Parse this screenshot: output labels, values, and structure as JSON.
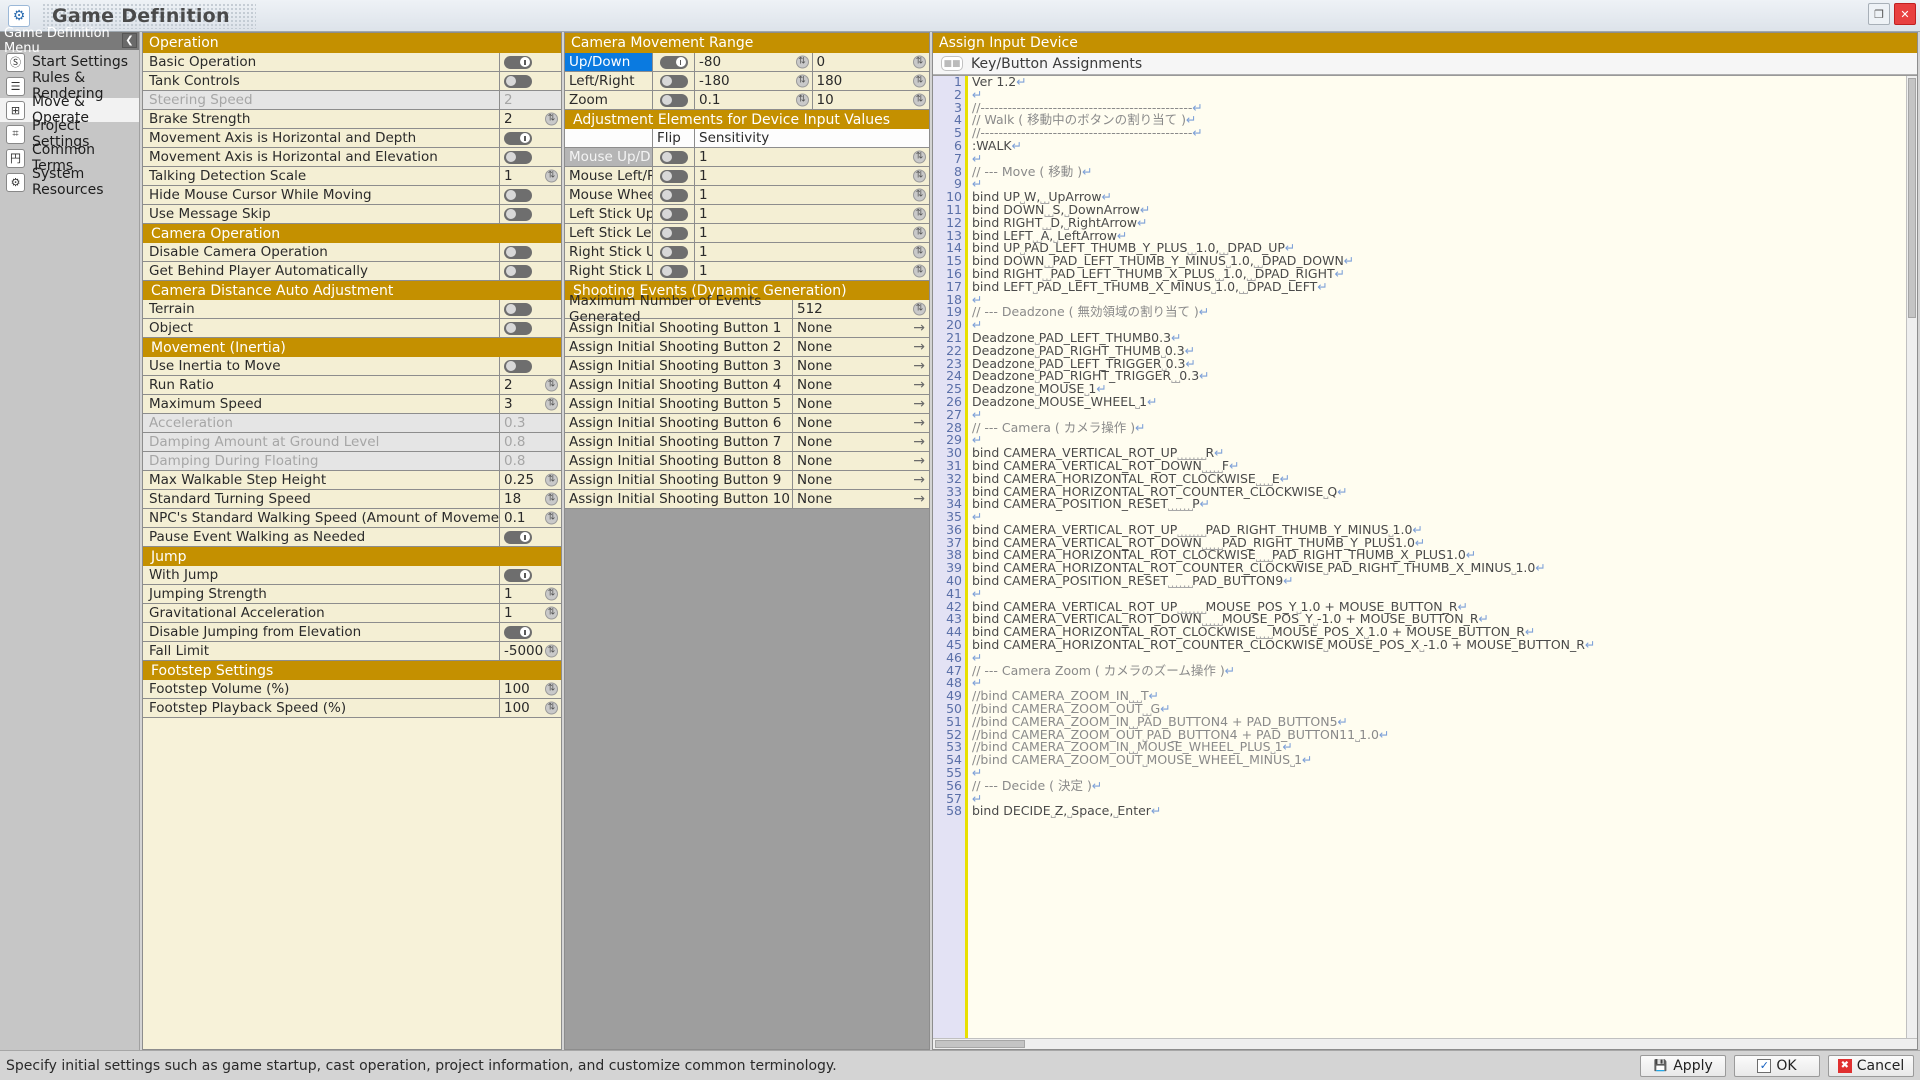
{
  "window": {
    "title": "Game Definition",
    "icon": "app-gear-icon",
    "buttons": {
      "restore": "❐",
      "close": "✕"
    }
  },
  "sidebar": {
    "header": "Game Definition Menu",
    "collapse": "❮",
    "items": [
      {
        "label": "Start Settings",
        "icon": "Ⓢ",
        "active": false
      },
      {
        "label": "Rules & Rendering",
        "icon": "☰",
        "active": false
      },
      {
        "label": "Move & Operate",
        "icon": "⊞",
        "active": true
      },
      {
        "label": "Project Settings",
        "icon": "⌗",
        "active": false
      },
      {
        "label": "Common Terms",
        "icon": "円",
        "active": false
      },
      {
        "label": "System Resources",
        "icon": "⚙",
        "active": false
      }
    ]
  },
  "operation_panel": {
    "header": "Operation",
    "rows": [
      {
        "kind": "row",
        "label": "Basic Operation",
        "type": "toggle",
        "on": true
      },
      {
        "kind": "row",
        "label": "Tank Controls",
        "type": "toggle",
        "on": false
      },
      {
        "kind": "row",
        "label": "Steering Speed",
        "type": "text",
        "value": "2",
        "disabled": true
      },
      {
        "kind": "row",
        "label": "Brake Strength",
        "type": "spin",
        "value": "2"
      },
      {
        "kind": "row",
        "label": "Movement Axis is Horizontal and Depth",
        "type": "toggle",
        "on": true
      },
      {
        "kind": "row",
        "label": "Movement Axis is Horizontal and Elevation",
        "type": "toggle",
        "on": false
      },
      {
        "kind": "row",
        "label": "Talking Detection Scale",
        "type": "spin",
        "value": "1"
      },
      {
        "kind": "row",
        "label": "Hide Mouse Cursor While Moving",
        "type": "toggle",
        "on": false
      },
      {
        "kind": "row",
        "label": "Use Message Skip",
        "type": "toggle",
        "on": false
      },
      {
        "kind": "group",
        "label": "Camera Operation"
      },
      {
        "kind": "row",
        "label": "Disable Camera Operation",
        "type": "toggle",
        "on": false
      },
      {
        "kind": "row",
        "label": "Get Behind Player Automatically",
        "type": "toggle",
        "on": false
      },
      {
        "kind": "group",
        "label": "Camera Distance Auto Adjustment"
      },
      {
        "kind": "row",
        "label": "Terrain",
        "type": "toggle",
        "on": false
      },
      {
        "kind": "row",
        "label": "Object",
        "type": "toggle",
        "on": false
      },
      {
        "kind": "group",
        "label": "Movement (Inertia)"
      },
      {
        "kind": "row",
        "label": "Use Inertia to Move",
        "type": "toggle",
        "on": false
      },
      {
        "kind": "row",
        "label": "Run Ratio",
        "type": "spin",
        "value": "2"
      },
      {
        "kind": "row",
        "label": "Maximum Speed",
        "type": "spin",
        "value": "3"
      },
      {
        "kind": "row",
        "label": "Acceleration",
        "type": "text",
        "value": "0.3",
        "disabled": true
      },
      {
        "kind": "row",
        "label": "Damping Amount at Ground Level",
        "type": "text",
        "value": "0.8",
        "disabled": true
      },
      {
        "kind": "row",
        "label": "Damping During Floating",
        "type": "text",
        "value": "0.8",
        "disabled": true
      },
      {
        "kind": "row",
        "label": "Max Walkable Step Height",
        "type": "spin",
        "value": "0.25"
      },
      {
        "kind": "row",
        "label": "Standard Turning Speed",
        "type": "spin",
        "value": "18"
      },
      {
        "kind": "row",
        "label": "NPC's Standard Walking Speed (Amount of Movement per Frame)",
        "type": "spin",
        "value": "0.1"
      },
      {
        "kind": "row",
        "label": "Pause Event Walking as Needed",
        "type": "toggle",
        "on": true
      },
      {
        "kind": "group",
        "label": "Jump"
      },
      {
        "kind": "row",
        "label": "With Jump",
        "type": "toggle",
        "on": true
      },
      {
        "kind": "row",
        "label": "Jumping Strength",
        "type": "spin",
        "value": "1"
      },
      {
        "kind": "row",
        "label": "Gravitational Acceleration",
        "type": "spin",
        "value": "1"
      },
      {
        "kind": "row",
        "label": "Disable Jumping from Elevation",
        "type": "toggle",
        "on": true
      },
      {
        "kind": "row",
        "label": "Fall Limit",
        "type": "spin",
        "value": "-5000"
      },
      {
        "kind": "group",
        "label": "Footstep Settings"
      },
      {
        "kind": "row",
        "label": "Footstep Volume (%)",
        "type": "spin",
        "value": "100"
      },
      {
        "kind": "row",
        "label": "Footstep Playback Speed (%)",
        "type": "spin",
        "value": "100"
      }
    ]
  },
  "camera_panel": {
    "header": "Camera Movement Range",
    "range_rows": [
      {
        "label": "Up/Down",
        "selected": true,
        "toggle_on": true,
        "min": "-80",
        "max": "0"
      },
      {
        "label": "Left/Right",
        "selected": false,
        "toggle_on": false,
        "min": "-180",
        "max": "180"
      },
      {
        "label": "Zoom",
        "selected": false,
        "toggle_on": false,
        "min": "0.1",
        "max": "10"
      }
    ],
    "adjust_header": "Adjustment Elements for Device Input Values",
    "adjust_columns": {
      "name": "",
      "flip": "Flip",
      "sensitivity": "Sensitivity"
    },
    "adjust_rows": [
      {
        "label": "Mouse Up/D…",
        "highlight": true,
        "flip_on": false,
        "sensitivity": "1"
      },
      {
        "label": "Mouse Left/R…",
        "highlight": false,
        "flip_on": false,
        "sensitivity": "1"
      },
      {
        "label": "Mouse Wheel",
        "highlight": false,
        "flip_on": false,
        "sensitivity": "1"
      },
      {
        "label": "Left Stick Up/…",
        "highlight": false,
        "flip_on": false,
        "sensitivity": "1"
      },
      {
        "label": "Left Stick Left…",
        "highlight": false,
        "flip_on": false,
        "sensitivity": "1"
      },
      {
        "label": "Right Stick U…",
        "highlight": false,
        "flip_on": false,
        "sensitivity": "1"
      },
      {
        "label": "Right Stick Le…",
        "highlight": false,
        "flip_on": false,
        "sensitivity": "1"
      }
    ],
    "shooting_header": "Shooting Events (Dynamic Generation)",
    "shooting_rows": [
      {
        "label": "Maximum Number of Events Generated",
        "value": "512",
        "type": "spin"
      },
      {
        "label": "Assign Initial Shooting Button 1",
        "value": "None",
        "type": "arrow"
      },
      {
        "label": "Assign Initial Shooting Button 2",
        "value": "None",
        "type": "arrow"
      },
      {
        "label": "Assign Initial Shooting Button 3",
        "value": "None",
        "type": "arrow"
      },
      {
        "label": "Assign Initial Shooting Button 4",
        "value": "None",
        "type": "arrow"
      },
      {
        "label": "Assign Initial Shooting Button 5",
        "value": "None",
        "type": "arrow"
      },
      {
        "label": "Assign Initial Shooting Button 6",
        "value": "None",
        "type": "arrow"
      },
      {
        "label": "Assign Initial Shooting Button 7",
        "value": "None",
        "type": "arrow"
      },
      {
        "label": "Assign Initial Shooting Button 8",
        "value": "None",
        "type": "arrow"
      },
      {
        "label": "Assign Initial Shooting Button 9",
        "value": "None",
        "type": "arrow"
      },
      {
        "label": "Assign Initial Shooting Button 10",
        "value": "None",
        "type": "arrow"
      }
    ]
  },
  "input_device_panel": {
    "header": "Assign Input Device",
    "subheader": "Key/Button Assignments",
    "subheader_icon": "gamepad-icon",
    "code_lines": [
      "Ver 1.2↵",
      "↵",
      "//-----------------------------------------------↵",
      "// Walk ( 移動中のボタンの割り当て )↵",
      "//-----------------------------------------------↵",
      ":WALK↵",
      "↵",
      "// --- Move ( 移動 )↵",
      "↵",
      "bind UP⎵W,⎵⎵UpArrow↵",
      "bind DOWN⎵⎵S,⎵DownArrow↵",
      "bind RIGHT⎵⎵D,⎵RightArrow↵",
      "bind LEFT⎵⎵A,⎵LeftArrow↵",
      "bind UP⎵PAD_LEFT_THUMB_Y_PLUS⎵⎵1.0,⎵⎵DPAD_UP↵",
      "bind DOWN⎵⎵PAD_LEFT_THUMB_Y_MINUS⎵1.0,⎵⎵DPAD_DOWN↵",
      "bind RIGHT⎵⎵PAD_LEFT_THUMB_X_PLUS⎵⎵1.0,⎵⎵DPAD_RIGHT↵",
      "bind LEFT⎵PAD_LEFT_THUMB_X_MINUS⎵1.0,⎵⎵DPAD_LEFT↵",
      "↵",
      "// --- Deadzone ( 無効領域の割り当て )↵",
      "↵",
      "Deadzone⎵PAD_LEFT_THUMB0.3↵",
      "Deadzone⎵PAD_RIGHT_THUMB⎵0.3↵",
      "Deadzone⎵PAD_LEFT_TRIGGER⎵0.3↵",
      "Deadzone⎵PAD_RIGHT_TRIGGER⎵⎵0.3↵",
      "Deadzone⎵MOUSE⎵1↵",
      "Deadzone⎵MOUSE_WHEEL⎵1↵",
      "↵",
      "// --- Camera ( カメラ操作 )↵",
      "↵",
      "bind CAMERA_VERTICAL_ROT_UP⎵⎵⎵⎵⎵⎵⎵R↵",
      "bind CAMERA_VERTICAL_ROT_DOWN⎵⎵⎵⎵⎵F↵",
      "bind CAMERA_HORIZONTAL_ROT_CLOCKWISE⎵⎵⎵⎵E↵",
      "bind CAMERA_HORIZONTAL_ROT_COUNTER_CLOCKWISE⎵Q↵",
      "bind CAMERA_POSITION_RESET⎵⎵⎵⎵⎵⎵P↵",
      "↵",
      "bind CAMERA_VERTICAL_ROT_UP⎵⎵⎵⎵⎵⎵⎵PAD_RIGHT_THUMB_Y_MINUS⎵1.0↵",
      "bind CAMERA_VERTICAL_ROT_DOWN⎵⎵⎵⎵⎵PAD_RIGHT_THUMB_Y_PLUS1.0↵",
      "bind CAMERA_HORIZONTAL_ROT_CLOCKWISE⎵⎵⎵⎵PAD_RIGHT_THUMB_X_PLUS1.0↵",
      "bind CAMERA_HORIZONTAL_ROT_COUNTER_CLOCKWISE⎵PAD_RIGHT_THUMB_X_MINUS⎵1.0↵",
      "bind CAMERA_POSITION_RESET⎵⎵⎵⎵⎵⎵PAD_BUTTON9↵",
      "↵",
      "bind CAMERA_VERTICAL_ROT_UP⎵⎵⎵⎵⎵⎵⎵MOUSE_POS_Y⎵1.0 + MOUSE_BUTTON_R↵",
      "bind CAMERA_VERTICAL_ROT_DOWN⎵⎵⎵⎵⎵MOUSE_POS_Y⎵-1.0 + MOUSE_BUTTON_R↵",
      "bind CAMERA_HORIZONTAL_ROT_CLOCKWISE⎵⎵⎵⎵MOUSE_POS_X⎵1.0 + MOUSE_BUTTON_R↵",
      "bind CAMERA_HORIZONTAL_ROT_COUNTER_CLOCKWISE⎵MOUSE_POS_X⎵-1.0 + MOUSE_BUTTON_R↵",
      "↵",
      "// --- Camera Zoom ( カメラのズーム操作 )↵",
      "↵",
      "//bind CAMERA_ZOOM_IN⎵⎵⎵T↵",
      "//bind CAMERA_ZOOM_OUT⎵⎵G↵",
      "//bind CAMERA_ZOOM_IN⎵⎵PAD_BUTTON4 + PAD_BUTTON5↵",
      "//bind CAMERA_ZOOM_OUT⎵PAD_BUTTON4 + PAD_BUTTON11⎵1.0↵",
      "//bind CAMERA_ZOOM_IN⎵⎵MOUSE_WHEEL_PLUS⎵1↵",
      "//bind CAMERA_ZOOM_OUT⎵MOUSE_WHEEL_MINUS⎵1↵",
      "↵",
      "// --- Decide ( 決定 )↵",
      "↵",
      "bind DECIDE⎵Z,⎵Space,⎵Enter↵"
    ]
  },
  "statusbar": {
    "message": "Specify initial settings such as game startup, cast operation, project information, and customize common terminology.",
    "apply": "Apply",
    "apply_icon": "apply-icon",
    "ok": "OK",
    "ok_icon": "check-icon",
    "cancel": "Cancel",
    "cancel_icon": "x-icon"
  },
  "colors": {
    "group_header": "#c49000",
    "row_bg": "#f4efd4",
    "selected": "#0a7ae0",
    "disabled_bg": "#e5e5e5"
  }
}
